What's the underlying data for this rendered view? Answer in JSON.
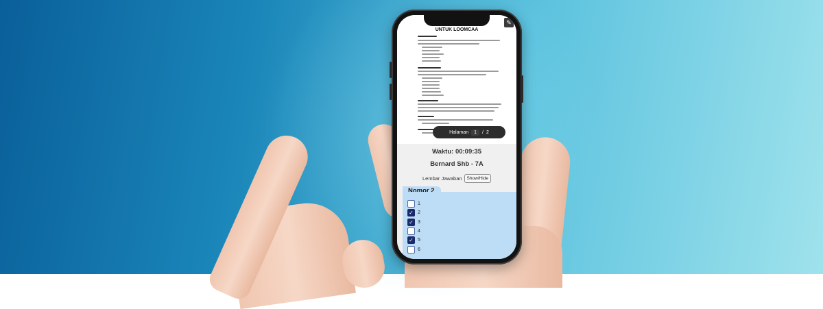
{
  "document": {
    "title": "UNTUK LOOMCAA"
  },
  "pager": {
    "label": "Halaman",
    "current": "1",
    "separator": "/",
    "total": "2"
  },
  "exam": {
    "timer": "Waktu: 00:09:35",
    "student": "Bernard Shb - 7A",
    "answer_sheet_label": "Lembar Jawaban",
    "show_hide_button": "Show/Hide"
  },
  "question": {
    "title": "Nomor 2",
    "options": [
      {
        "label": "1",
        "checked": false
      },
      {
        "label": "2",
        "checked": true
      },
      {
        "label": "3",
        "checked": true
      },
      {
        "label": "4",
        "checked": false
      },
      {
        "label": "5",
        "checked": true
      },
      {
        "label": "6",
        "checked": false
      }
    ]
  }
}
